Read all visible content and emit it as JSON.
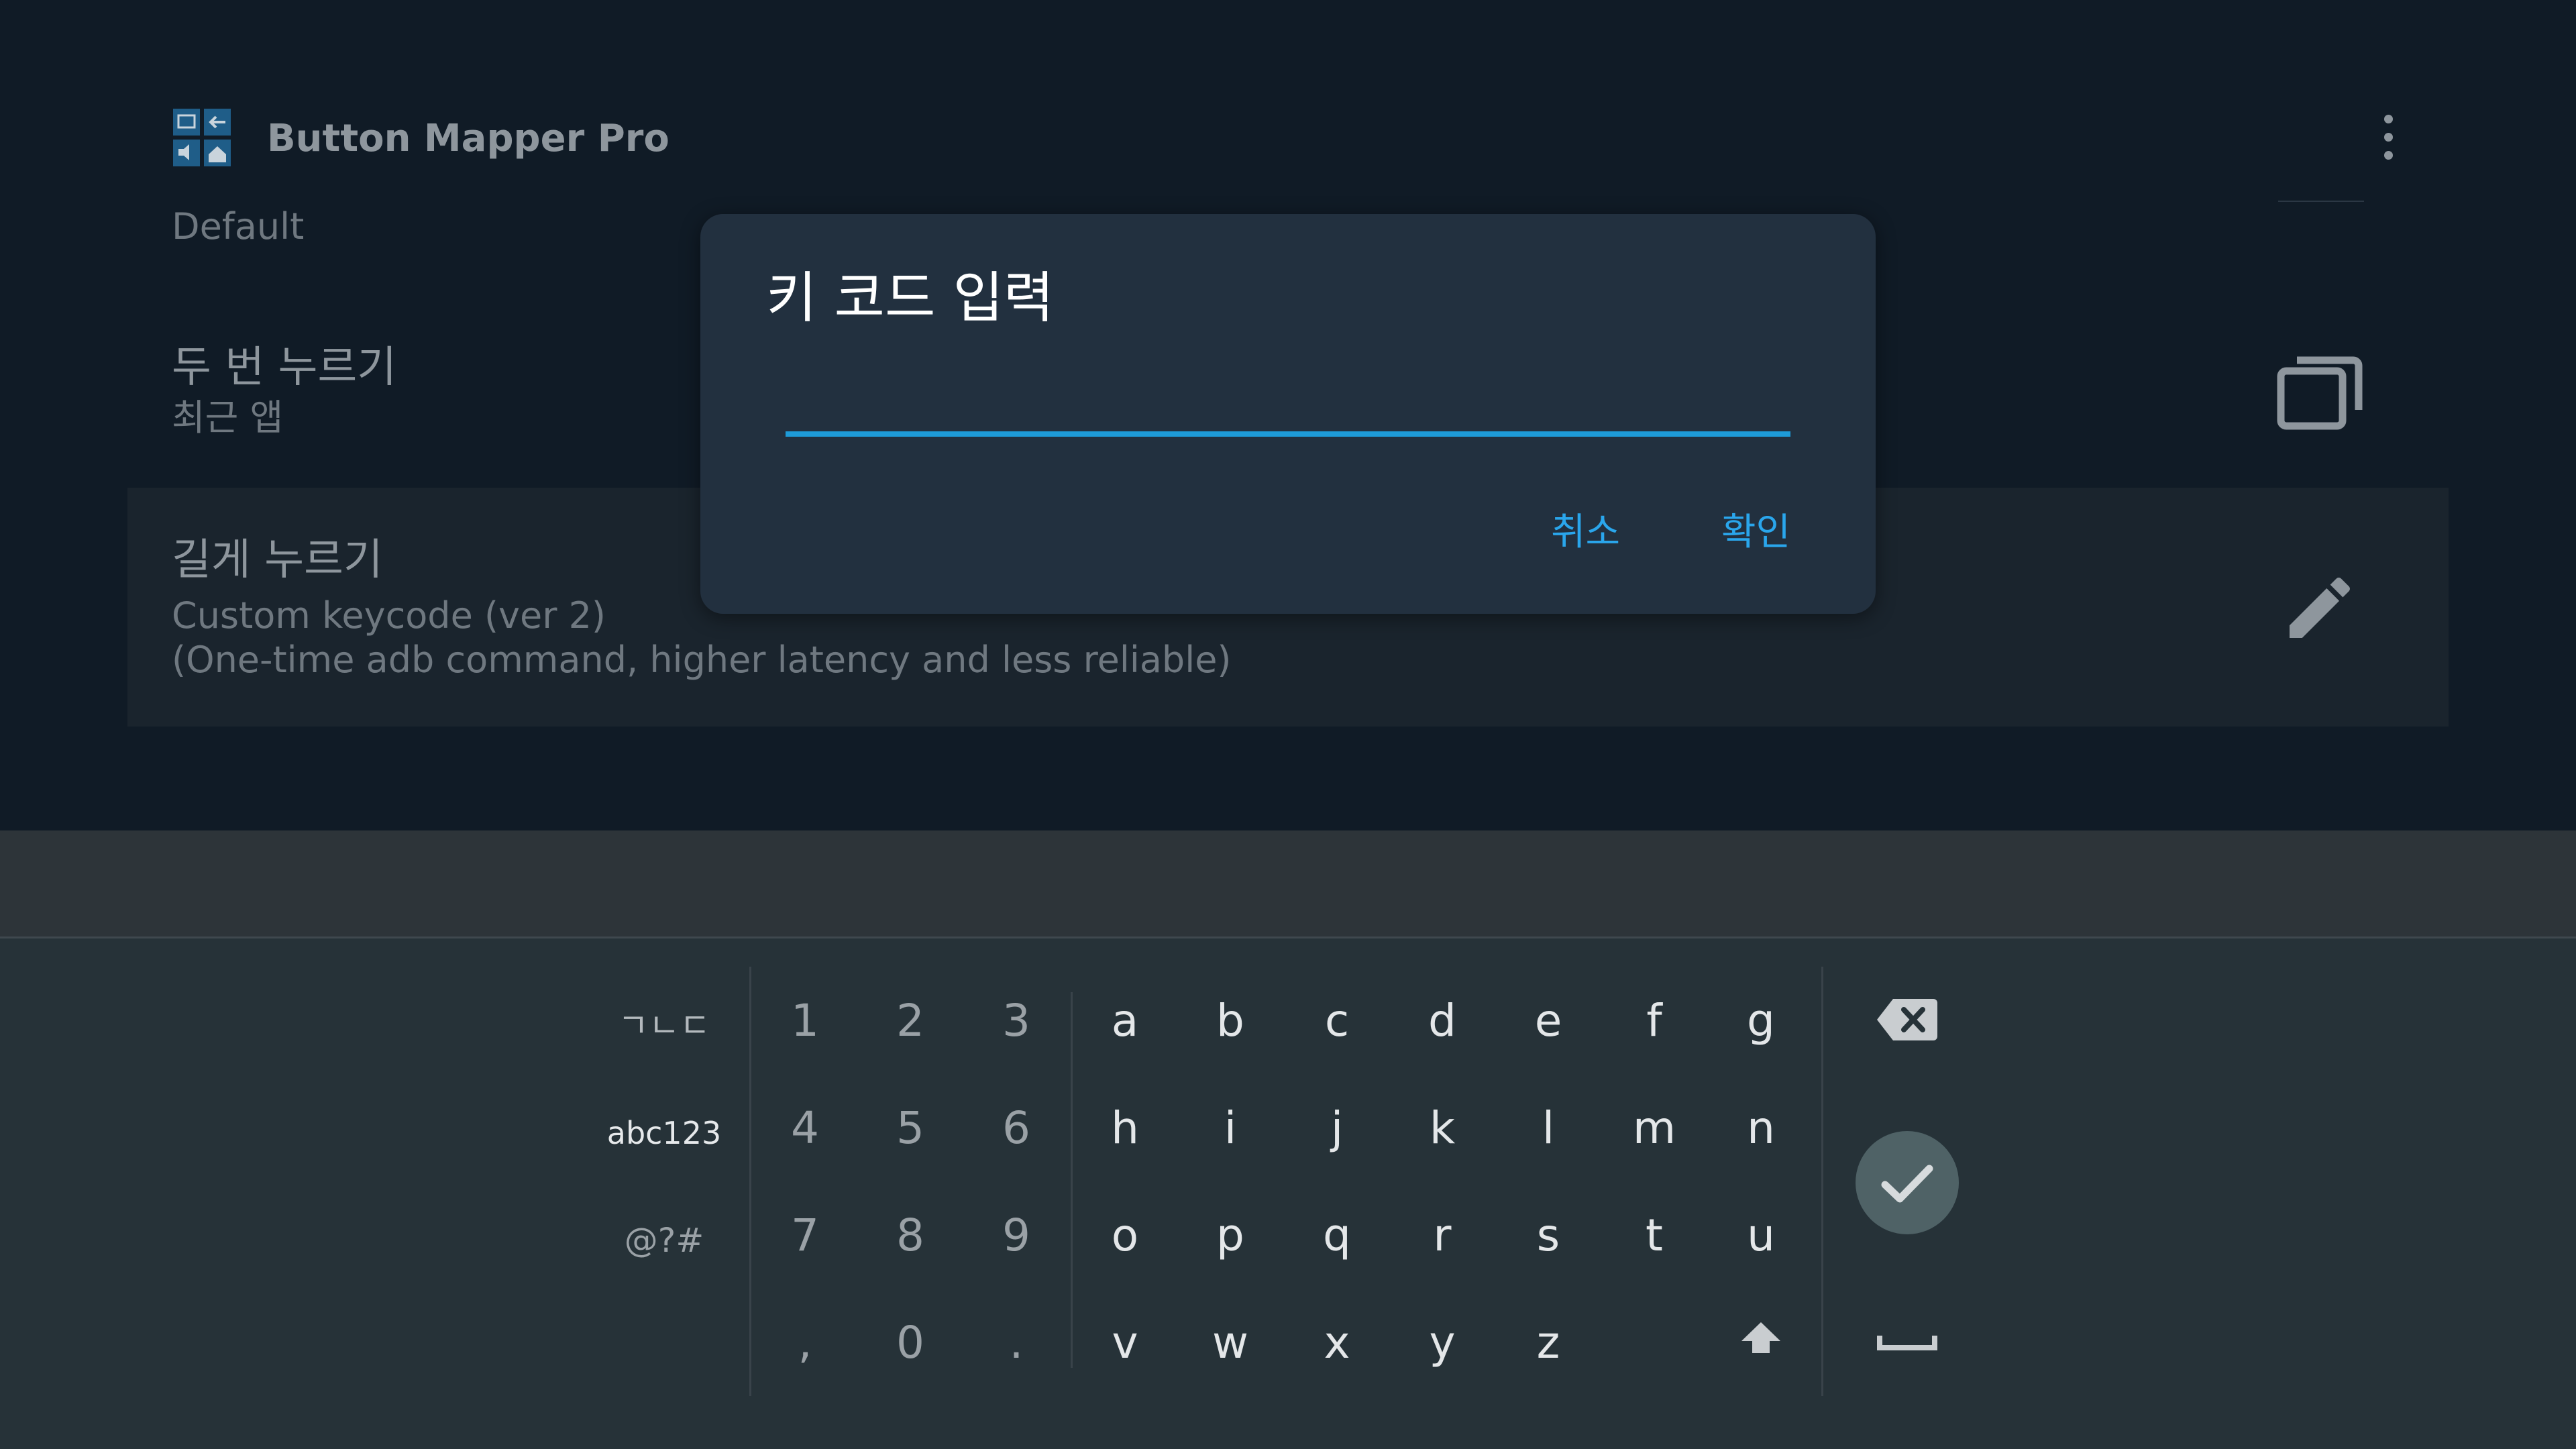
{
  "app": {
    "title": "Button Mapper Pro",
    "profile": "Default",
    "rows": {
      "double_press": {
        "title": "두 번 누르기",
        "value": "최근 앱"
      },
      "long_press": {
        "title": "길게 누르기",
        "value_line1": "Custom keycode (ver 2)",
        "value_line2": "(One-time adb command, higher latency and less reliable)"
      }
    },
    "icons": {
      "logo": "app-logo-icon",
      "overflow": "more-vert-icon",
      "recents": "recent-apps-icon",
      "edit": "pencil-icon"
    }
  },
  "dialog": {
    "title": "키 코드 입력",
    "input": {
      "value": "",
      "placeholder": ""
    },
    "cancel_label": "취소",
    "ok_label": "확인",
    "accent": "#2aa6ec"
  },
  "keyboard": {
    "modes": {
      "hangul": "ㄱㄴㄷ",
      "abc": "abc123",
      "symbols": "@?#"
    },
    "number_rows": [
      [
        "1",
        "2",
        "3"
      ],
      [
        "4",
        "5",
        "6"
      ],
      [
        "7",
        "8",
        "9"
      ],
      [
        ",",
        "0",
        "."
      ]
    ],
    "letter_rows": [
      [
        "a",
        "b",
        "c",
        "d",
        "e",
        "f",
        "g"
      ],
      [
        "h",
        "i",
        "j",
        "k",
        "l",
        "m",
        "n"
      ],
      [
        "o",
        "p",
        "q",
        "r",
        "s",
        "t",
        "u"
      ],
      [
        "v",
        "w",
        "x",
        "y",
        "z"
      ]
    ],
    "icons": {
      "backspace": "backspace-icon",
      "enter": "check-icon",
      "shift": "shift-arrow-icon",
      "space": "space-bar-icon"
    },
    "colors": {
      "background": "#263238",
      "enter_button": "#4f6266"
    }
  }
}
